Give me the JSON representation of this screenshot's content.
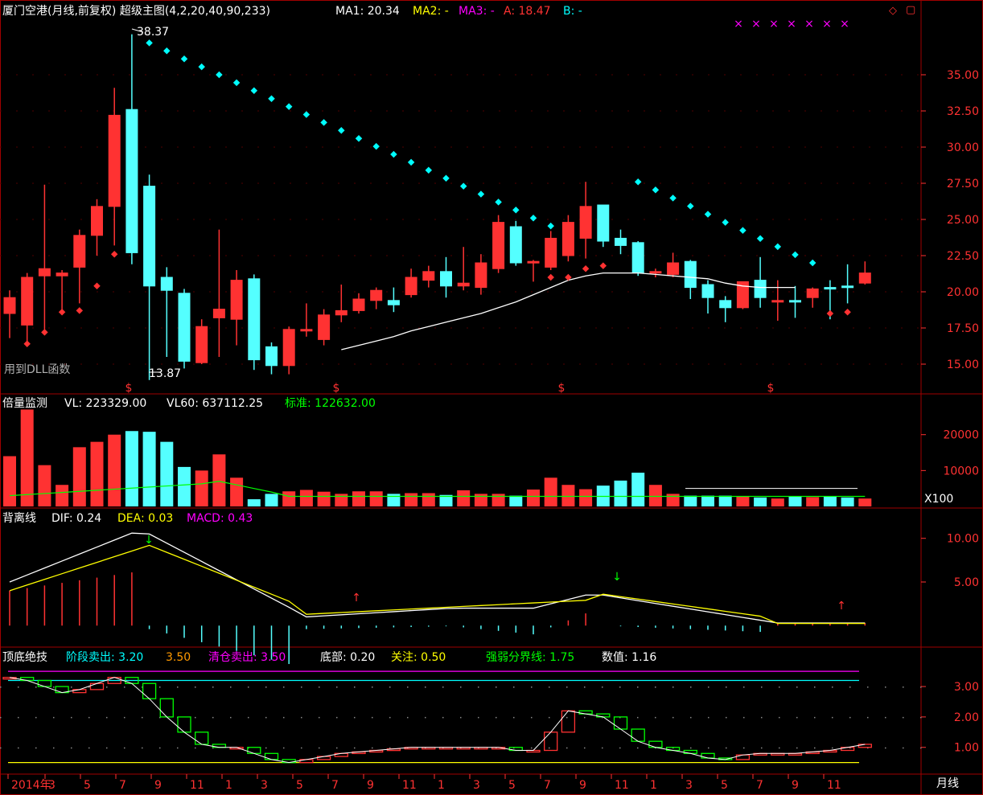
{
  "colors": {
    "up": "#ff3232",
    "down": "#54ffff",
    "grid": "#a00000",
    "white": "#ffffff",
    "yellow": "#ffff00",
    "magenta": "#ff00ff",
    "cyan": "#00ffff",
    "green": "#00ff00",
    "orange": "#ff9900",
    "axis": "#ff3232"
  },
  "main": {
    "title": "厦门空港(月线,前复权) 超级主图(4,2,20,40,90,233)",
    "ma1_label": "MA1: 20.34",
    "ma2_label": "MA2: -",
    "ma3_label": "MA3: -",
    "a_label": "A: 18.47",
    "b_label": "B: -",
    "high_note": "38.37",
    "low_note": "13.87",
    "dll_note": "用到DLL函数",
    "yticks": [
      "35.00",
      "32.50",
      "30.00",
      "27.50",
      "25.00",
      "22.50",
      "20.00",
      "17.50",
      "15.00"
    ],
    "s_marker": "$"
  },
  "vol": {
    "title": "倍量监测",
    "vl_label": "VL: 223329.00",
    "vl60_label": "VL60: 637112.25",
    "std_label": "标准: 122632.00",
    "yticks": [
      "20000",
      "10000"
    ],
    "unit": "X100"
  },
  "macd": {
    "title": "背离线",
    "dif_label": "DIF: 0.24",
    "dea_label": "DEA: 0.03",
    "macd_label": "MACD: 0.43",
    "yticks": [
      "10.00",
      "5.00"
    ]
  },
  "bottom": {
    "title": "顶底绝技",
    "l1": "阶段卖出: 3.20",
    "l2": "3.50",
    "l3": "清仓卖出: 3.50",
    "l4": "底部: 0.20",
    "l5": "关注: 0.50",
    "l6": "强弱分界线: 1.75",
    "l7": "数值: 1.16",
    "yticks": [
      "3.00",
      "2.00",
      "1.00"
    ]
  },
  "xaxis": {
    "labels": [
      "2014年",
      "3",
      "5",
      "7",
      "9",
      "11",
      "1",
      "3",
      "5",
      "7",
      "9",
      "11",
      "1",
      "3",
      "5",
      "7",
      "9",
      "11",
      "1",
      "3",
      "5",
      "7",
      "9",
      "11"
    ],
    "period": "月线"
  },
  "chart_data": {
    "type": "candlestick",
    "series": [
      {
        "name": "K线",
        "ohlc": [
          [
            18.5,
            19.6,
            16.8,
            20.1
          ],
          [
            17.7,
            21.0,
            16.5,
            21.3
          ],
          [
            21.1,
            21.6,
            17.4,
            27.4
          ],
          [
            21.1,
            21.3,
            18.8,
            21.5
          ],
          [
            21.7,
            23.9,
            19.2,
            24.3
          ],
          [
            23.9,
            25.9,
            22.5,
            26.4
          ],
          [
            25.9,
            32.2,
            23.2,
            34.1
          ],
          [
            32.6,
            22.7,
            21.9,
            37.8
          ],
          [
            27.3,
            20.4,
            13.9,
            28.1
          ],
          [
            21.0,
            20.1,
            15.5,
            21.7
          ],
          [
            19.9,
            15.2,
            14.7,
            20.2
          ],
          [
            15.1,
            17.6,
            15.0,
            18.1
          ],
          [
            18.2,
            18.8,
            15.5,
            24.3
          ],
          [
            18.1,
            20.8,
            16.3,
            21.5
          ],
          [
            20.9,
            15.3,
            14.6,
            21.2
          ],
          [
            16.2,
            14.9,
            14.3,
            16.5
          ],
          [
            14.9,
            17.4,
            14.3,
            17.6
          ],
          [
            17.3,
            17.4,
            16.9,
            19.2
          ],
          [
            16.7,
            18.4,
            16.3,
            18.8
          ],
          [
            18.4,
            18.7,
            17.9,
            20.5
          ],
          [
            18.7,
            19.5,
            18.5,
            19.9
          ],
          [
            19.4,
            20.1,
            18.8,
            20.3
          ],
          [
            19.4,
            19.1,
            18.6,
            20.3
          ],
          [
            19.8,
            21.0,
            19.6,
            21.6
          ],
          [
            20.8,
            21.4,
            20.3,
            21.8
          ],
          [
            21.4,
            20.4,
            19.6,
            22.4
          ],
          [
            20.4,
            20.6,
            20.1,
            23.1
          ],
          [
            20.3,
            22.0,
            19.8,
            22.6
          ],
          [
            21.6,
            24.8,
            21.3,
            25.3
          ],
          [
            24.5,
            22.0,
            21.8,
            24.9
          ],
          [
            22.1,
            22.1,
            20.7,
            22.2
          ],
          [
            21.7,
            23.7,
            21.5,
            24.2
          ],
          [
            22.5,
            24.8,
            22.1,
            25.3
          ],
          [
            23.7,
            25.9,
            22.3,
            27.6
          ],
          [
            26.0,
            23.5,
            23.1,
            26.0
          ],
          [
            23.7,
            23.2,
            22.6,
            24.3
          ],
          [
            23.4,
            21.3,
            21.1,
            23.5
          ],
          [
            21.3,
            21.4,
            21.0,
            21.6
          ],
          [
            21.2,
            22.0,
            21.0,
            22.7
          ],
          [
            22.1,
            20.3,
            19.5,
            22.2
          ],
          [
            20.5,
            19.6,
            18.5,
            20.8
          ],
          [
            19.4,
            18.9,
            17.9,
            19.7
          ],
          [
            18.9,
            20.7,
            18.8,
            20.7
          ],
          [
            20.8,
            19.6,
            18.9,
            22.4
          ],
          [
            19.4,
            19.4,
            18.0,
            20.8
          ],
          [
            19.4,
            19.3,
            18.2,
            20.4
          ],
          [
            19.6,
            20.2,
            18.9,
            20.3
          ],
          [
            20.3,
            20.2,
            18.1,
            20.8
          ],
          [
            20.4,
            20.3,
            19.2,
            21.9
          ],
          [
            20.6,
            21.3,
            20.5,
            22.1
          ]
        ]
      },
      {
        "name": "MA1",
        "values": [
          null,
          null,
          null,
          null,
          null,
          null,
          null,
          null,
          null,
          null,
          null,
          null,
          null,
          null,
          null,
          null,
          null,
          null,
          null,
          16.0,
          16.3,
          16.6,
          16.9,
          17.3,
          17.6,
          17.9,
          18.2,
          18.5,
          18.9,
          19.3,
          19.8,
          20.3,
          20.8,
          21.1,
          21.3,
          21.3,
          21.3,
          21.2,
          21.1,
          21.0,
          20.9,
          20.6,
          20.4,
          20.3,
          20.3,
          20.3
        ]
      }
    ],
    "ylim": [
      13.5,
      38.5
    ],
    "volume": [
      140,
      270,
      115,
      60,
      165,
      180,
      200,
      210,
      208,
      180,
      110,
      100,
      145,
      80,
      20,
      35,
      42,
      46,
      41,
      35,
      42,
      42,
      35,
      37,
      37,
      32,
      45,
      35,
      35,
      30,
      47,
      80,
      60,
      48,
      58,
      72,
      94,
      60,
      35,
      30,
      30,
      30,
      27,
      25,
      22,
      27,
      26,
      27,
      25,
      22,
      20,
      20
    ],
    "macd_ylim": [
      -2,
      12
    ],
    "x_range": [
      2014.0,
      2018.0
    ]
  }
}
